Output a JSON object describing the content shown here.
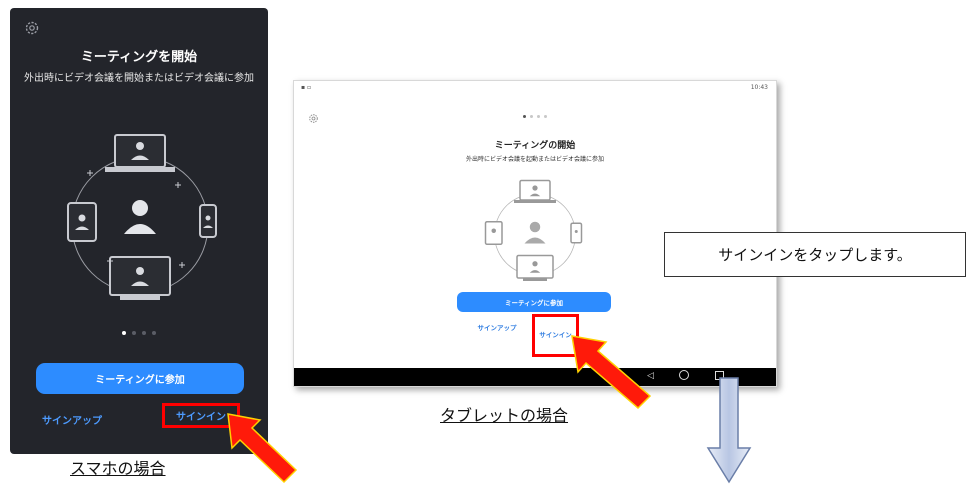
{
  "phone": {
    "title": "ミーティングを開始",
    "subtitle": "外出時にビデオ会議を開始またはビデオ会議に参加",
    "join_label": "ミーティングに参加",
    "signup_label": "サインアップ",
    "signin_label": "サインイン",
    "caption": "スマホの場合"
  },
  "tablet": {
    "status_right": "10:43",
    "title": "ミーティングの開始",
    "subtitle": "外出時にビデオ会議を起動またはビデオ会議に参加",
    "join_label": "ミーティングに参加",
    "signup_label": "サインアップ",
    "signin_label": "サインイン",
    "caption": "タブレットの場合"
  },
  "callout": {
    "text": "サインインをタップします。"
  },
  "colors": {
    "accent_blue": "#2d8cff",
    "highlight_red": "#ff0000",
    "phone_bg": "#23252b"
  },
  "icons": [
    "gear-icon",
    "red-arrow-icon",
    "down-arrow-icon"
  ]
}
